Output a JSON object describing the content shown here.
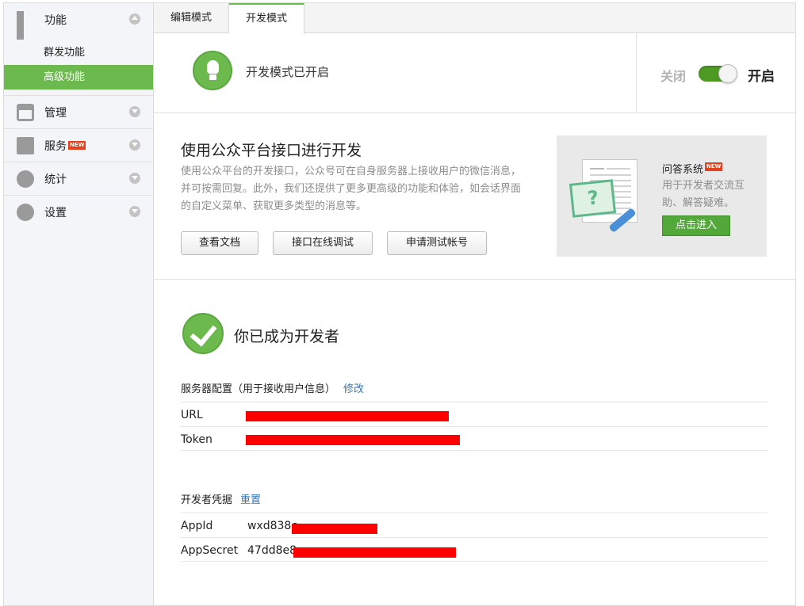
{
  "sidebar": {
    "groups": [
      {
        "label": "功能",
        "icon": "grid-icon",
        "expanded": true,
        "items": [
          {
            "label": "群发功能",
            "active": false
          },
          {
            "label": "高级功能",
            "active": true
          }
        ]
      },
      {
        "label": "管理",
        "icon": "tray-icon",
        "expanded": false
      },
      {
        "label": "服务",
        "icon": "printer-icon",
        "badge": "NEW",
        "expanded": false
      },
      {
        "label": "统计",
        "icon": "pie-chart-icon",
        "expanded": false
      },
      {
        "label": "设置",
        "icon": "gear-icon",
        "expanded": false
      }
    ]
  },
  "tabs": [
    {
      "label": "编辑模式",
      "active": false
    },
    {
      "label": "开发模式",
      "active": true
    }
  ],
  "status": {
    "text": "开发模式已开启",
    "off_label": "关闭",
    "on_label": "开启",
    "enabled": true
  },
  "intro": {
    "title": "使用公众平台接口进行开发",
    "description": "使用公众平台的开发接口，公众号可在自身服务器上接收用户的微信消息，并可按需回复。此外，我们还提供了更多更高级的功能和体验，如会话界面的自定义菜单、获取更多类型的消息等。",
    "buttons": [
      "查看文档",
      "接口在线调试",
      "申请测试帐号"
    ]
  },
  "promo": {
    "title": "问答系统",
    "badge": "NEW",
    "description": "用于开发者交流互助、解答疑难。",
    "button": "点击进入"
  },
  "developer": {
    "title": "你已成为开发者",
    "server_config": {
      "heading": "服务器配置（用于接收用户信息）",
      "edit_link": "修改",
      "fields": [
        {
          "key": "URL",
          "value": "",
          "redacted": true
        },
        {
          "key": "Token",
          "value": "",
          "redacted": true
        }
      ]
    },
    "credentials": {
      "heading": "开发者凭据",
      "reset_link": "重置",
      "fields": [
        {
          "key": "AppId",
          "value": "wxd838c",
          "redacted": true
        },
        {
          "key": "AppSecret",
          "value": "47dd8e8",
          "redacted": true
        }
      ]
    }
  },
  "colors": {
    "accent_green": "#6cb94e",
    "link_blue": "#3476b8",
    "redaction_red": "#ff0000",
    "badge_red": "#e5411f"
  }
}
